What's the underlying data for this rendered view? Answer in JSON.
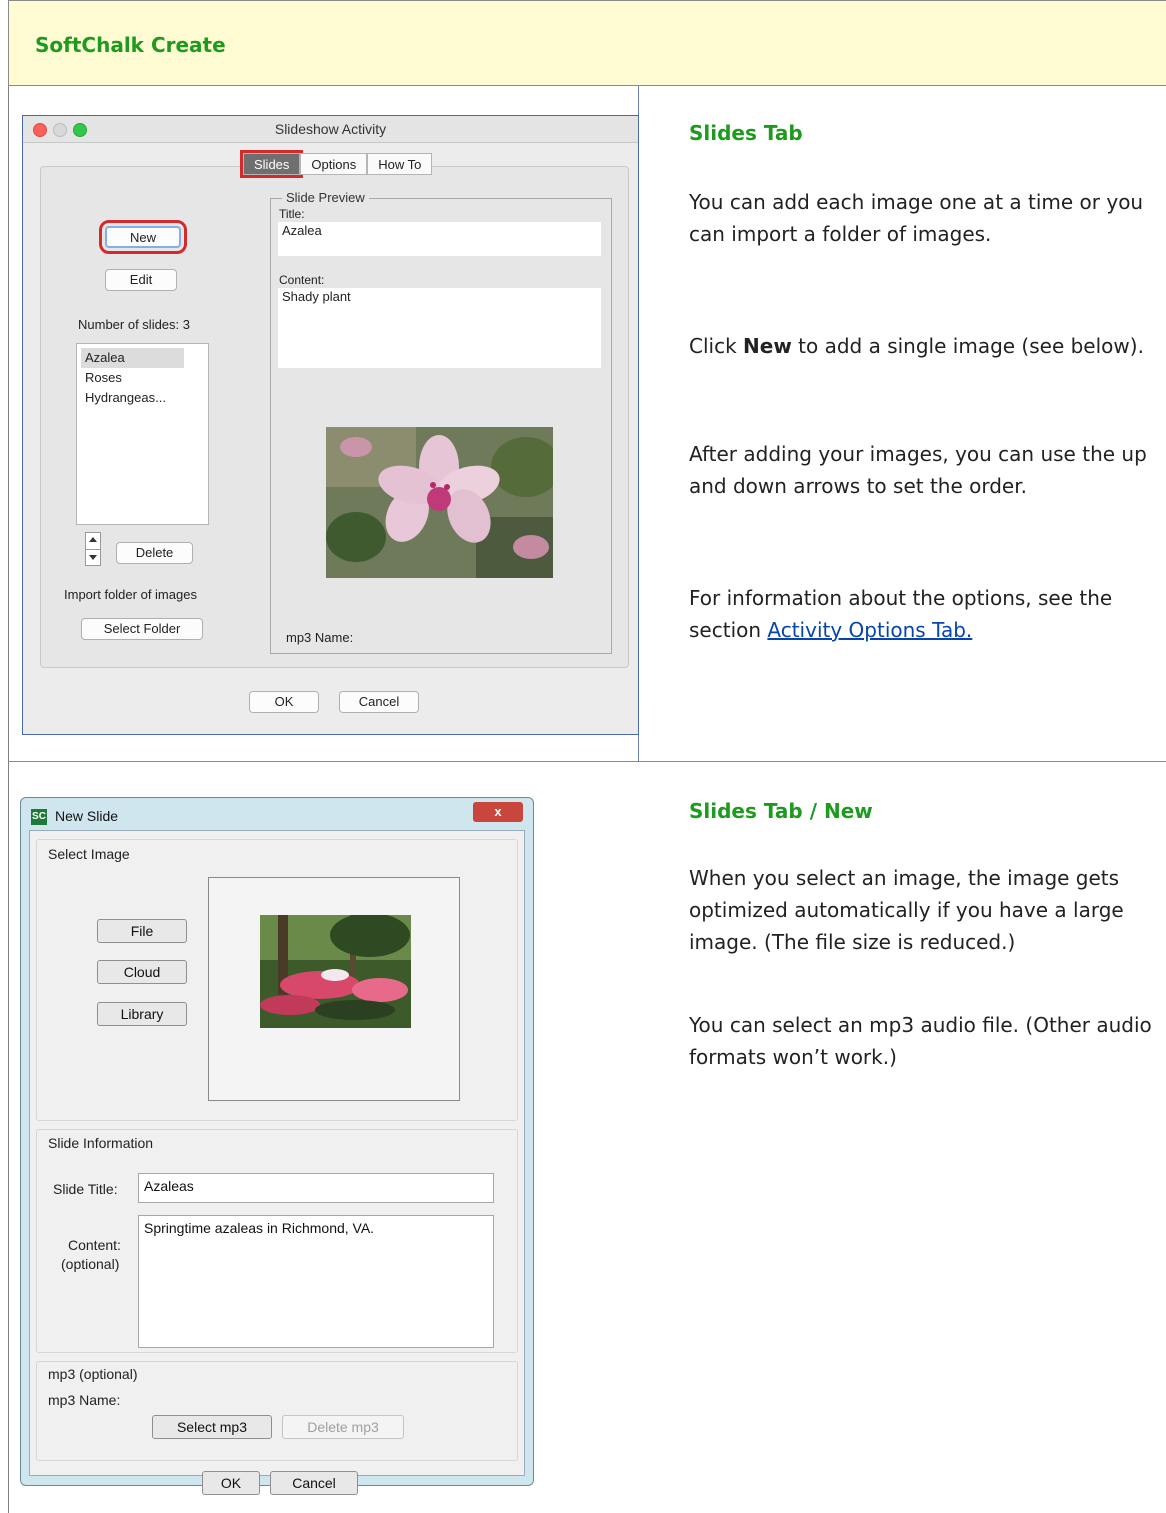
{
  "header": {
    "title": "SoftChalk Create"
  },
  "section1": {
    "title": "Slides Tab",
    "p1": "You can add each image one at a time or you can import a folder of images.",
    "p2_pre": "Click ",
    "p2_bold": "New",
    "p2_post": " to add a single image (see below).",
    "p3": "After adding your images, you can use the up and down arrows to set the order.",
    "p4_pre": "For information about the options, see the section ",
    "p4_link": "Activity Options Tab."
  },
  "section2": {
    "title": "Slides Tab / New",
    "p1": "When you select an image, the image gets optimized automatically if you have a large image. (The file size is reduced.)",
    "p2": "You can select an mp3 audio file. (Other audio formats won’t work.)"
  },
  "mac_dialog": {
    "title": "Slideshow Activity",
    "tabs": [
      "Slides",
      "Options",
      "How To"
    ],
    "new_label": "New",
    "edit_label": "Edit",
    "num_slides": "Number of slides: 3",
    "slides": [
      "Azalea",
      "Roses",
      "Hydrangeas..."
    ],
    "delete_label": "Delete",
    "import_label": "Import folder of images",
    "select_folder_label": "Select Folder",
    "preview_legend": "Slide Preview",
    "title_label": "Title:",
    "title_value": "Azalea",
    "content_label": "Content:",
    "content_value": "Shady plant",
    "mp3_label": "mp3 Name:",
    "ok_label": "OK",
    "cancel_label": "Cancel",
    "traffic_colors": [
      "#fc605c",
      "#d8d8d8",
      "#34c84a"
    ]
  },
  "win_dialog": {
    "title": "New Slide",
    "logo": "SC",
    "close": "x",
    "select_image": "Select Image",
    "file": "File",
    "cloud": "Cloud",
    "library": "Library",
    "slide_info": "Slide Information",
    "slide_title_label": "Slide Title:",
    "slide_title_value": "Azaleas",
    "content_label": "Content:",
    "content_optional": "(optional)",
    "content_value": "Springtime azaleas in Richmond, VA.",
    "mp3_group": "mp3 (optional)",
    "mp3_name": "mp3 Name:",
    "select_mp3": "Select mp3",
    "delete_mp3": "Delete mp3",
    "ok": "OK",
    "cancel": "Cancel"
  }
}
